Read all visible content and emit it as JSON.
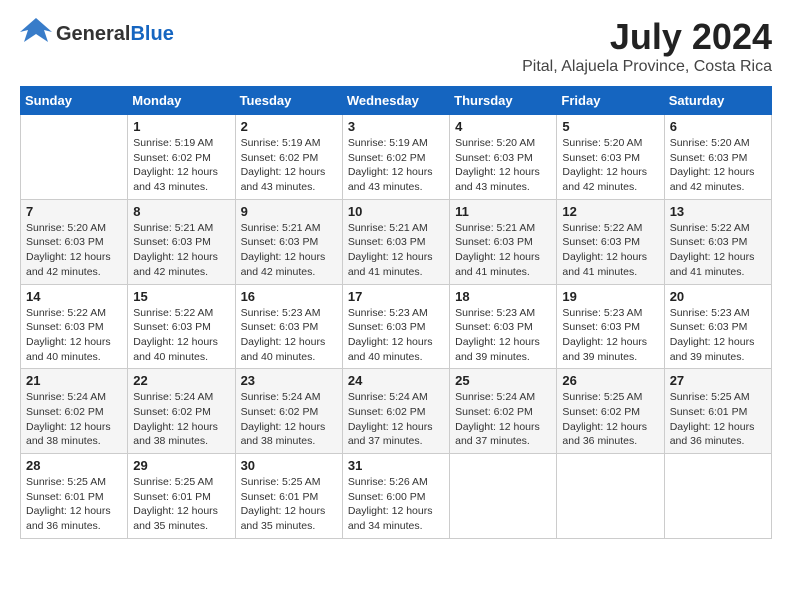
{
  "header": {
    "logo_line1": "General",
    "logo_line2": "Blue",
    "title": "July 2024",
    "subtitle": "Pital, Alajuela Province, Costa Rica"
  },
  "calendar": {
    "days_of_week": [
      "Sunday",
      "Monday",
      "Tuesday",
      "Wednesday",
      "Thursday",
      "Friday",
      "Saturday"
    ],
    "weeks": [
      [
        {
          "num": "",
          "info": ""
        },
        {
          "num": "1",
          "info": "Sunrise: 5:19 AM\nSunset: 6:02 PM\nDaylight: 12 hours\nand 43 minutes."
        },
        {
          "num": "2",
          "info": "Sunrise: 5:19 AM\nSunset: 6:02 PM\nDaylight: 12 hours\nand 43 minutes."
        },
        {
          "num": "3",
          "info": "Sunrise: 5:19 AM\nSunset: 6:02 PM\nDaylight: 12 hours\nand 43 minutes."
        },
        {
          "num": "4",
          "info": "Sunrise: 5:20 AM\nSunset: 6:03 PM\nDaylight: 12 hours\nand 43 minutes."
        },
        {
          "num": "5",
          "info": "Sunrise: 5:20 AM\nSunset: 6:03 PM\nDaylight: 12 hours\nand 42 minutes."
        },
        {
          "num": "6",
          "info": "Sunrise: 5:20 AM\nSunset: 6:03 PM\nDaylight: 12 hours\nand 42 minutes."
        }
      ],
      [
        {
          "num": "7",
          "info": "Sunrise: 5:20 AM\nSunset: 6:03 PM\nDaylight: 12 hours\nand 42 minutes."
        },
        {
          "num": "8",
          "info": "Sunrise: 5:21 AM\nSunset: 6:03 PM\nDaylight: 12 hours\nand 42 minutes."
        },
        {
          "num": "9",
          "info": "Sunrise: 5:21 AM\nSunset: 6:03 PM\nDaylight: 12 hours\nand 42 minutes."
        },
        {
          "num": "10",
          "info": "Sunrise: 5:21 AM\nSunset: 6:03 PM\nDaylight: 12 hours\nand 41 minutes."
        },
        {
          "num": "11",
          "info": "Sunrise: 5:21 AM\nSunset: 6:03 PM\nDaylight: 12 hours\nand 41 minutes."
        },
        {
          "num": "12",
          "info": "Sunrise: 5:22 AM\nSunset: 6:03 PM\nDaylight: 12 hours\nand 41 minutes."
        },
        {
          "num": "13",
          "info": "Sunrise: 5:22 AM\nSunset: 6:03 PM\nDaylight: 12 hours\nand 41 minutes."
        }
      ],
      [
        {
          "num": "14",
          "info": "Sunrise: 5:22 AM\nSunset: 6:03 PM\nDaylight: 12 hours\nand 40 minutes."
        },
        {
          "num": "15",
          "info": "Sunrise: 5:22 AM\nSunset: 6:03 PM\nDaylight: 12 hours\nand 40 minutes."
        },
        {
          "num": "16",
          "info": "Sunrise: 5:23 AM\nSunset: 6:03 PM\nDaylight: 12 hours\nand 40 minutes."
        },
        {
          "num": "17",
          "info": "Sunrise: 5:23 AM\nSunset: 6:03 PM\nDaylight: 12 hours\nand 40 minutes."
        },
        {
          "num": "18",
          "info": "Sunrise: 5:23 AM\nSunset: 6:03 PM\nDaylight: 12 hours\nand 39 minutes."
        },
        {
          "num": "19",
          "info": "Sunrise: 5:23 AM\nSunset: 6:03 PM\nDaylight: 12 hours\nand 39 minutes."
        },
        {
          "num": "20",
          "info": "Sunrise: 5:23 AM\nSunset: 6:03 PM\nDaylight: 12 hours\nand 39 minutes."
        }
      ],
      [
        {
          "num": "21",
          "info": "Sunrise: 5:24 AM\nSunset: 6:02 PM\nDaylight: 12 hours\nand 38 minutes."
        },
        {
          "num": "22",
          "info": "Sunrise: 5:24 AM\nSunset: 6:02 PM\nDaylight: 12 hours\nand 38 minutes."
        },
        {
          "num": "23",
          "info": "Sunrise: 5:24 AM\nSunset: 6:02 PM\nDaylight: 12 hours\nand 38 minutes."
        },
        {
          "num": "24",
          "info": "Sunrise: 5:24 AM\nSunset: 6:02 PM\nDaylight: 12 hours\nand 37 minutes."
        },
        {
          "num": "25",
          "info": "Sunrise: 5:24 AM\nSunset: 6:02 PM\nDaylight: 12 hours\nand 37 minutes."
        },
        {
          "num": "26",
          "info": "Sunrise: 5:25 AM\nSunset: 6:02 PM\nDaylight: 12 hours\nand 36 minutes."
        },
        {
          "num": "27",
          "info": "Sunrise: 5:25 AM\nSunset: 6:01 PM\nDaylight: 12 hours\nand 36 minutes."
        }
      ],
      [
        {
          "num": "28",
          "info": "Sunrise: 5:25 AM\nSunset: 6:01 PM\nDaylight: 12 hours\nand 36 minutes."
        },
        {
          "num": "29",
          "info": "Sunrise: 5:25 AM\nSunset: 6:01 PM\nDaylight: 12 hours\nand 35 minutes."
        },
        {
          "num": "30",
          "info": "Sunrise: 5:25 AM\nSunset: 6:01 PM\nDaylight: 12 hours\nand 35 minutes."
        },
        {
          "num": "31",
          "info": "Sunrise: 5:26 AM\nSunset: 6:00 PM\nDaylight: 12 hours\nand 34 minutes."
        },
        {
          "num": "",
          "info": ""
        },
        {
          "num": "",
          "info": ""
        },
        {
          "num": "",
          "info": ""
        }
      ]
    ]
  }
}
